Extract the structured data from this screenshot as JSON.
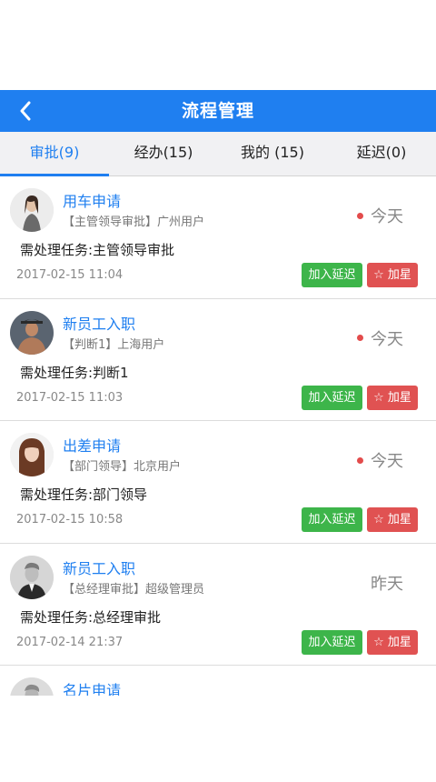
{
  "header": {
    "title": "流程管理",
    "back_icon": "back-chevron-icon"
  },
  "tabs": [
    {
      "label": "审批(9)",
      "active": true
    },
    {
      "label": "经办(15)",
      "active": false
    },
    {
      "label": "我的 (15)",
      "active": false
    },
    {
      "label": "延迟(0)",
      "active": false
    }
  ],
  "colors": {
    "primary": "#1f7ff0",
    "delay_button": "#3db54a",
    "star_button": "#e05252",
    "unread_dot": "#e34b4b"
  },
  "items": [
    {
      "title": "用车申请",
      "subtitle": "【主管领导审批】广州用户",
      "status": "今天",
      "unread": true,
      "task": "需处理任务:主管领导审批",
      "time": "2017-02-15 11:04",
      "delay_label": "加入延迟",
      "star_label": "☆ 加星"
    },
    {
      "title": "新员工入职",
      "subtitle": "【判断1】上海用户",
      "status": "今天",
      "unread": true,
      "task": "需处理任务:判断1",
      "time": "2017-02-15 11:03",
      "delay_label": "加入延迟",
      "star_label": "☆ 加星"
    },
    {
      "title": "出差申请",
      "subtitle": "【部门领导】北京用户",
      "status": "今天",
      "unread": true,
      "task": "需处理任务:部门领导",
      "time": "2017-02-15 10:58",
      "delay_label": "加入延迟",
      "star_label": "☆ 加星"
    },
    {
      "title": "新员工入职",
      "subtitle": "【总经理审批】超级管理员",
      "status": "昨天",
      "unread": false,
      "task": "需处理任务:总经理审批",
      "time": "2017-02-14 21:37",
      "delay_label": "加入延迟",
      "star_label": "☆ 加星"
    },
    {
      "title": "名片申请",
      "subtitle": "",
      "status": "",
      "unread": false,
      "task": "",
      "time": "",
      "delay_label": "",
      "star_label": ""
    }
  ]
}
